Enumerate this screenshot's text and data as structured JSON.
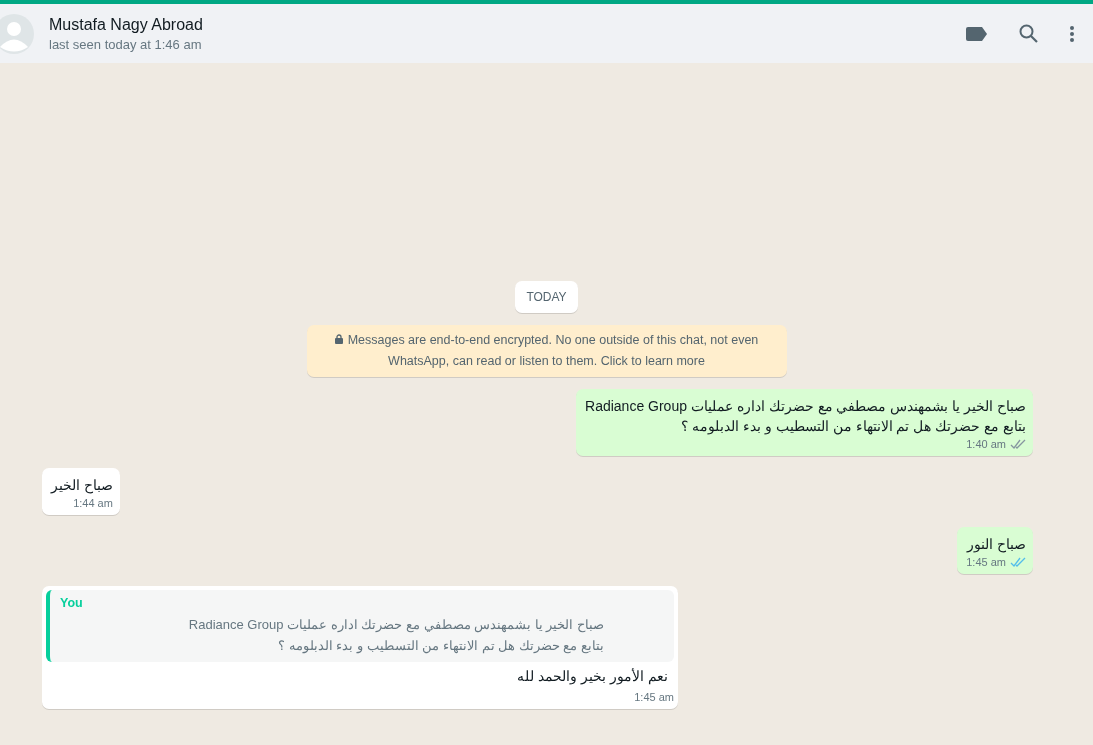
{
  "header": {
    "name": "Mustafa Nagy Abroad",
    "status": "last seen today at 1:46 am"
  },
  "date_chip": "TODAY",
  "encryption_notice": "Messages are end-to-end encrypted. No one outside of this chat, not even WhatsApp, can read or listen to them. Click to learn more",
  "messages": [
    {
      "kind": "outgoing",
      "text": "صباح الخير يا بشمهندس مصطفي مع  حضرتك اداره عمليات Radiance Group\nبتابع مع حضرتك هل تم الانتهاء من التسطيب و بدء الدبلومه ؟",
      "time": "1:40 am",
      "read": false
    },
    {
      "kind": "incoming",
      "text": "صباح الخير",
      "time": "1:44 am"
    },
    {
      "kind": "outgoing",
      "text": "صباح النور",
      "time": "1:45 am",
      "read": true
    },
    {
      "kind": "incoming",
      "quote": {
        "author": "You",
        "text": "صباح الخير يا بشمهندس مصطفي مع  حضرتك اداره عمليات Radiance Group\nبتابع مع حضرتك هل تم الانتهاء من التسطيب و بدء الدبلومه ؟"
      },
      "text": "نعم الأمور بخير والحمد لله",
      "time": "1:45 am"
    }
  ]
}
